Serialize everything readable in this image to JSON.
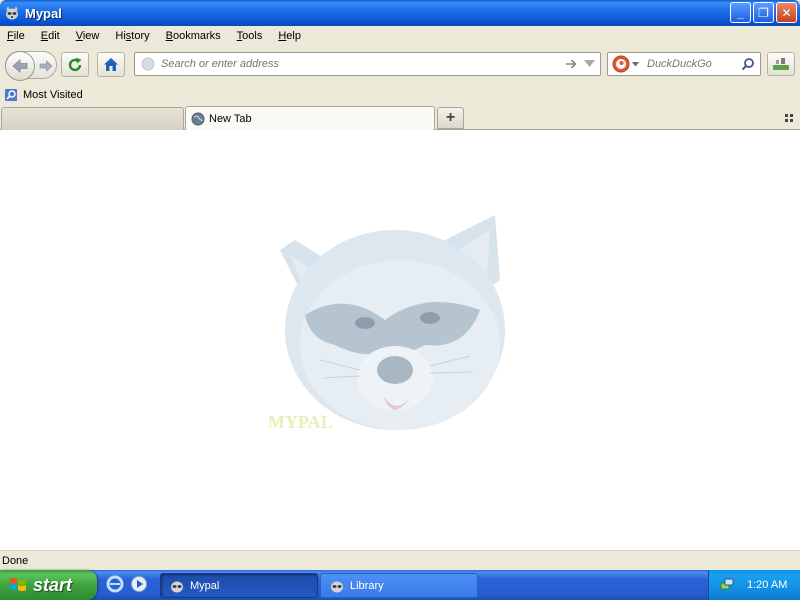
{
  "window": {
    "title": "Mypal",
    "min_glyph": "_",
    "max_glyph": "❐",
    "close_glyph": "✕"
  },
  "menu": {
    "items": [
      {
        "label": "File",
        "key": "F"
      },
      {
        "label": "Edit",
        "key": "E"
      },
      {
        "label": "View",
        "key": "V"
      },
      {
        "label": "History",
        "key": "s"
      },
      {
        "label": "Bookmarks",
        "key": "B"
      },
      {
        "label": "Tools",
        "key": "T"
      },
      {
        "label": "Help",
        "key": "H"
      }
    ]
  },
  "navbar": {
    "url_placeholder": "Search or enter address",
    "url_value": "",
    "search_placeholder": "DuckDuckGo",
    "search_value": ""
  },
  "bookmarks": {
    "items": [
      {
        "label": "Most Visited"
      }
    ]
  },
  "tabs": {
    "items": [
      {
        "label": "",
        "active": false
      },
      {
        "label": "New Tab",
        "active": true
      }
    ],
    "new_tab_glyph": "+"
  },
  "content": {
    "logo_text": "MYPAL"
  },
  "status": {
    "text": "Done"
  },
  "taskbar": {
    "start_label": "start",
    "tasks": [
      {
        "label": "Mypal",
        "active": true
      },
      {
        "label": "Library",
        "active": false
      }
    ],
    "clock": "1:20 AM"
  },
  "colors": {
    "titlebar": "#0b53cf",
    "taskbar": "#245dd0",
    "start_button": "#3ea43e",
    "tray": "#0f86de",
    "chrome": "#ece9d8"
  }
}
